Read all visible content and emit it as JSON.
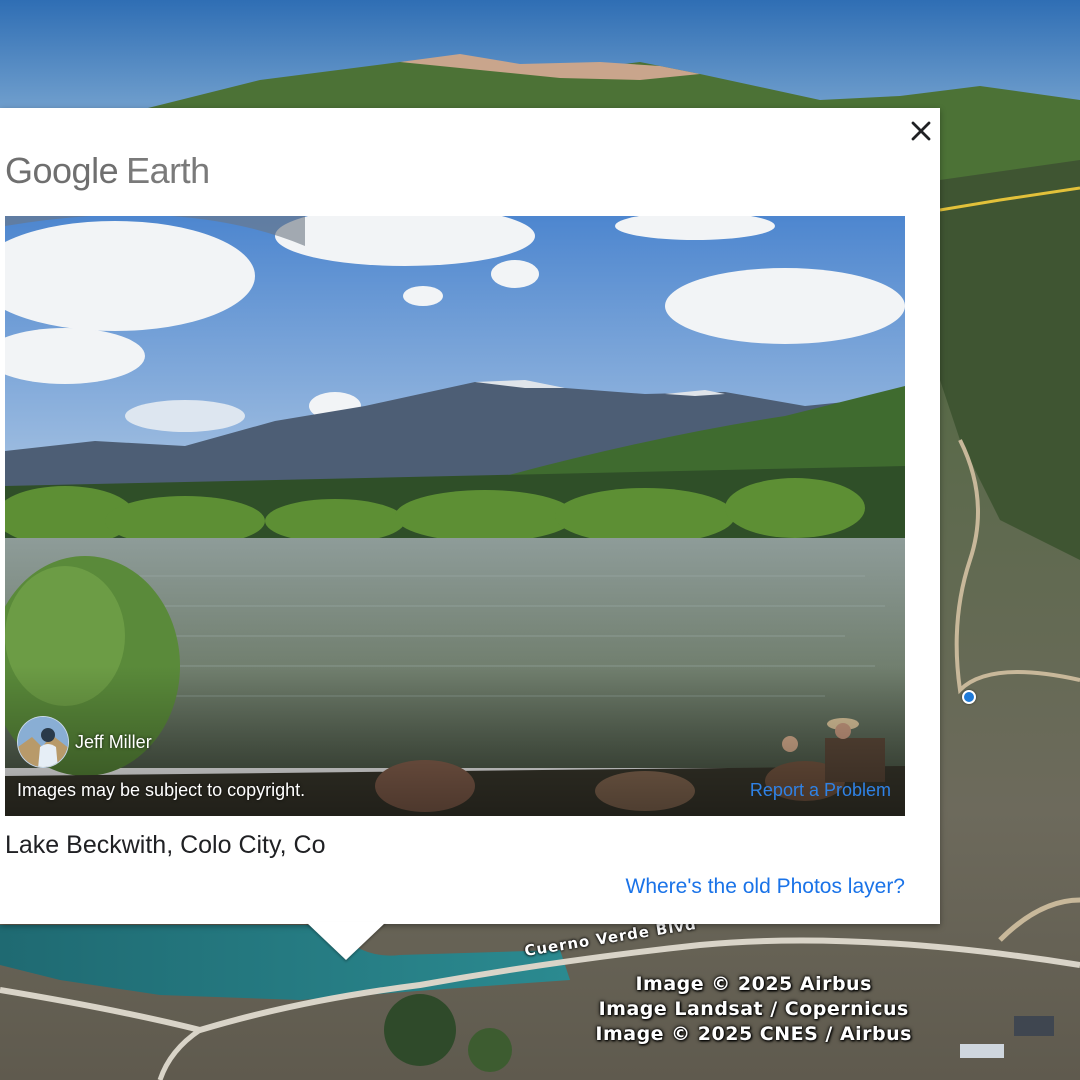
{
  "app": {
    "name_part1": "Google",
    "name_part2": "Earth"
  },
  "card": {
    "close_icon": "close-icon",
    "photo": {
      "author_name": "Jeff Miller",
      "copyright_notice": "Images may be subject to copyright.",
      "report_label": "Report a Problem"
    },
    "place_title": "Lake Beckwith, Colo City, Co",
    "old_photos_link": "Where's the old Photos layer?"
  },
  "map": {
    "road_label": "Cuerno Verde Blvd",
    "attribution": [
      "Image © 2025 Airbus",
      "Image Landsat / Copernicus",
      "Image © 2025 CNES / Airbus"
    ]
  },
  "colors": {
    "link_blue": "#1a73e8",
    "logo_gray": "#757575",
    "card_bg": "#ffffff"
  }
}
